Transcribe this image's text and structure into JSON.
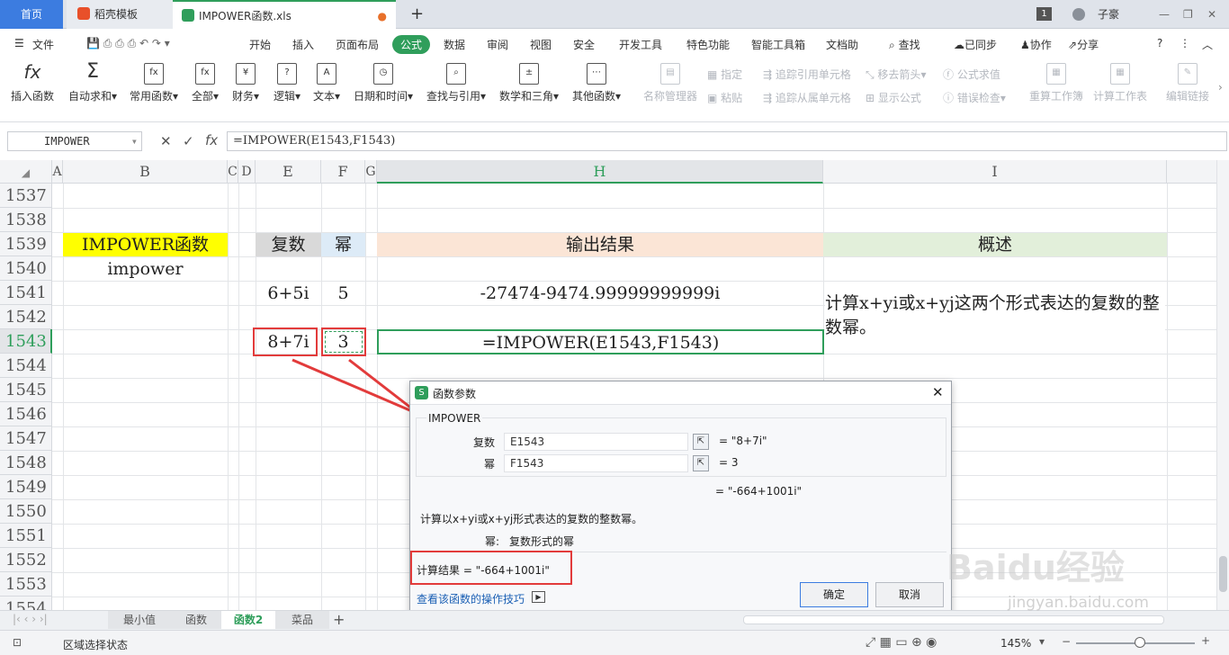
{
  "tabs": {
    "home": "首页",
    "daoke": "稻壳模板",
    "file": "IMPOWER函数.xls",
    "user": "子豪",
    "badge": "1"
  },
  "menu": {
    "file": "文件",
    "items": [
      "开始",
      "插入",
      "页面布局",
      "公式",
      "数据",
      "审阅",
      "视图",
      "安全",
      "开发工具",
      "特色功能",
      "智能工具箱",
      "文档助"
    ],
    "search": "查找",
    "sync": "已同步",
    "collab": "协作",
    "share": "分享"
  },
  "ribbon": {
    "insert_fn": "插入函数",
    "autosum": "自动求和",
    "common": "常用函数",
    "all": "全部",
    "finance": "财务",
    "logic": "逻辑",
    "text": "文本",
    "datetime": "日期和时间",
    "lookup": "查找与引用",
    "math": "数学和三角",
    "other": "其他函数",
    "name_mgr": "名称管理器",
    "specify": "指定",
    "paste": "粘贴",
    "trace_prec": "追踪引用单元格",
    "trace_dep": "追踪从属单元格",
    "remove_arrows": "移去箭头",
    "show_formula": "显示公式",
    "eval": "公式求值",
    "err_check": "错误检查",
    "recalc_book": "重算工作簿",
    "calc_sheet": "计算工作表",
    "edit_links": "编辑链接"
  },
  "formula_bar": {
    "name_box": "IMPOWER",
    "formula": "=IMPOWER(E1543,F1543)"
  },
  "columns": [
    "A",
    "B",
    "C",
    "D",
    "E",
    "F",
    "G",
    "H",
    "I"
  ],
  "rows": [
    "1537",
    "1538",
    "1539",
    "1540",
    "1541",
    "1542",
    "1543",
    "1544",
    "1545",
    "1546",
    "1547",
    "1548",
    "1549",
    "1550",
    "1551",
    "1552",
    "1553",
    "1554"
  ],
  "cells": {
    "b1539": "IMPOWER函数",
    "b1540": "impower",
    "e1539": "复数",
    "f1539": "幂",
    "h1539": "输出结果",
    "i1539": "概述",
    "e1541": "6+5i",
    "f1541": "5",
    "h1541": "-27474-9474.99999999999i",
    "i1541": "计算x+yi或x+yj这两个形式表达的复数的整数幂。",
    "e1543": "8+7i",
    "f1543": "3",
    "h1543": "=IMPOWER(E1543,F1543)"
  },
  "sheet_tabs": [
    "最小值",
    "函数",
    "函数2",
    "菜品"
  ],
  "status": {
    "mode": "区域选择状态",
    "zoom": "145%"
  },
  "dialog": {
    "title": "函数参数",
    "fn": "IMPOWER",
    "arg1_label": "复数",
    "arg1_value": "E1543",
    "arg1_result": "= \"8+7i\"",
    "arg2_label": "幂",
    "arg2_value": "F1543",
    "arg2_result": "= 3",
    "total": "= \"-664+1001i\"",
    "desc": "计算以x+yi或x+yj形式表达的复数的整数幂。",
    "param_label": "幂:",
    "param_desc": "复数形式的幂",
    "result_label": "计算结果 = \"-664+1001i\"",
    "help": "查看该函数的操作技巧",
    "ok": "确定",
    "cancel": "取消"
  },
  "watermark": {
    "text": "Baidu经验",
    "url": "jingyan.baidu.com"
  },
  "colors": {
    "yellow": "#ffff00",
    "orange_header": "#fbe5d6",
    "green_header": "#e2efda",
    "gray_header": "#d9d9d9",
    "blue_header": "#ddebf7",
    "accent": "#2f9e5b",
    "red": "#e23b3b"
  }
}
